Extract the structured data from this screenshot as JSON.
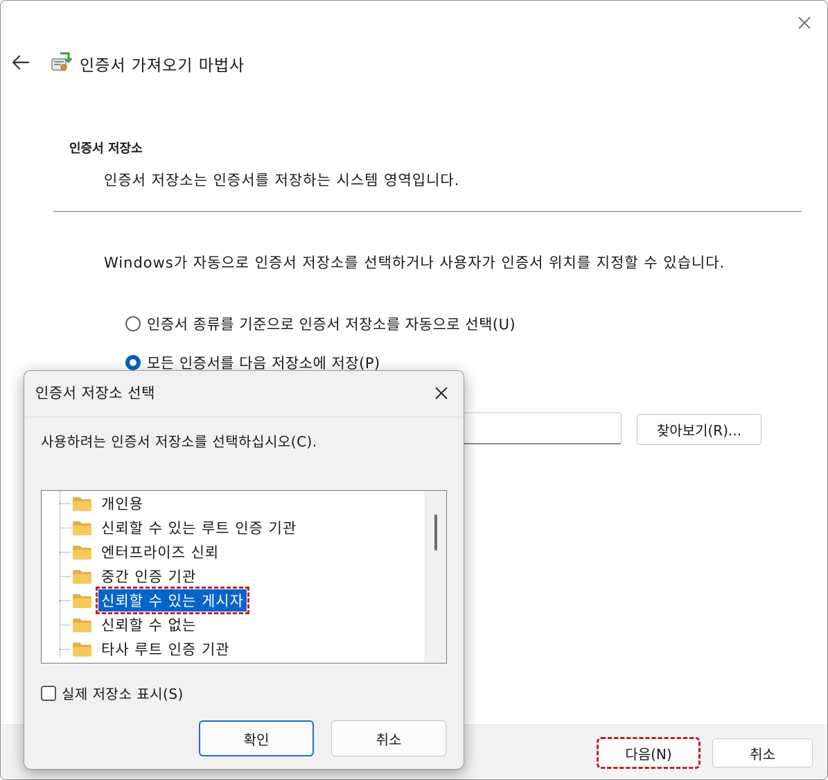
{
  "wizard": {
    "title": "인증서 가져오기 마법사",
    "section_title": "인증서 저장소",
    "section_desc": "인증서 저장소는 인증서를 저장하는 시스템 영역입니다.",
    "intro": "Windows가 자동으로 인증서 저장소를 선택하거나 사용자가 인증서 위치를 지정할 수 있습니다.",
    "radio_auto": "인증서 종류를 기준으로 인증서 저장소를 자동으로 선택(U)",
    "radio_manual": "모든 인증서를 다음 저장소에 저장(P)",
    "store_value": "",
    "browse": "찾아보기(R)...",
    "next": "다음(N)",
    "cancel": "취소"
  },
  "dialog": {
    "title": "인증서 저장소 선택",
    "prompt": "사용하려는 인증서 저장소를 선택하십시오(C).",
    "stores": [
      "개인용",
      "신뢰할 수 있는 루트 인증 기관",
      "엔터프라이즈 신뢰",
      "중간 인증 기관",
      "신뢰할 수 있는 게시자",
      "신뢰할 수 없는",
      "타사 루트 인증 기관"
    ],
    "selected_index": 4,
    "show_physical": "실제 저장소 표시(S)",
    "ok": "확인",
    "cancel": "취소"
  },
  "icons": {
    "back": "back-arrow-icon",
    "close": "close-icon",
    "wizard": "certificate-wizard-icon",
    "folder": "folder-icon"
  },
  "colors": {
    "accent": "#0a64c8",
    "highlight_dash": "#c41e2a",
    "folder": "#f5c95a"
  }
}
